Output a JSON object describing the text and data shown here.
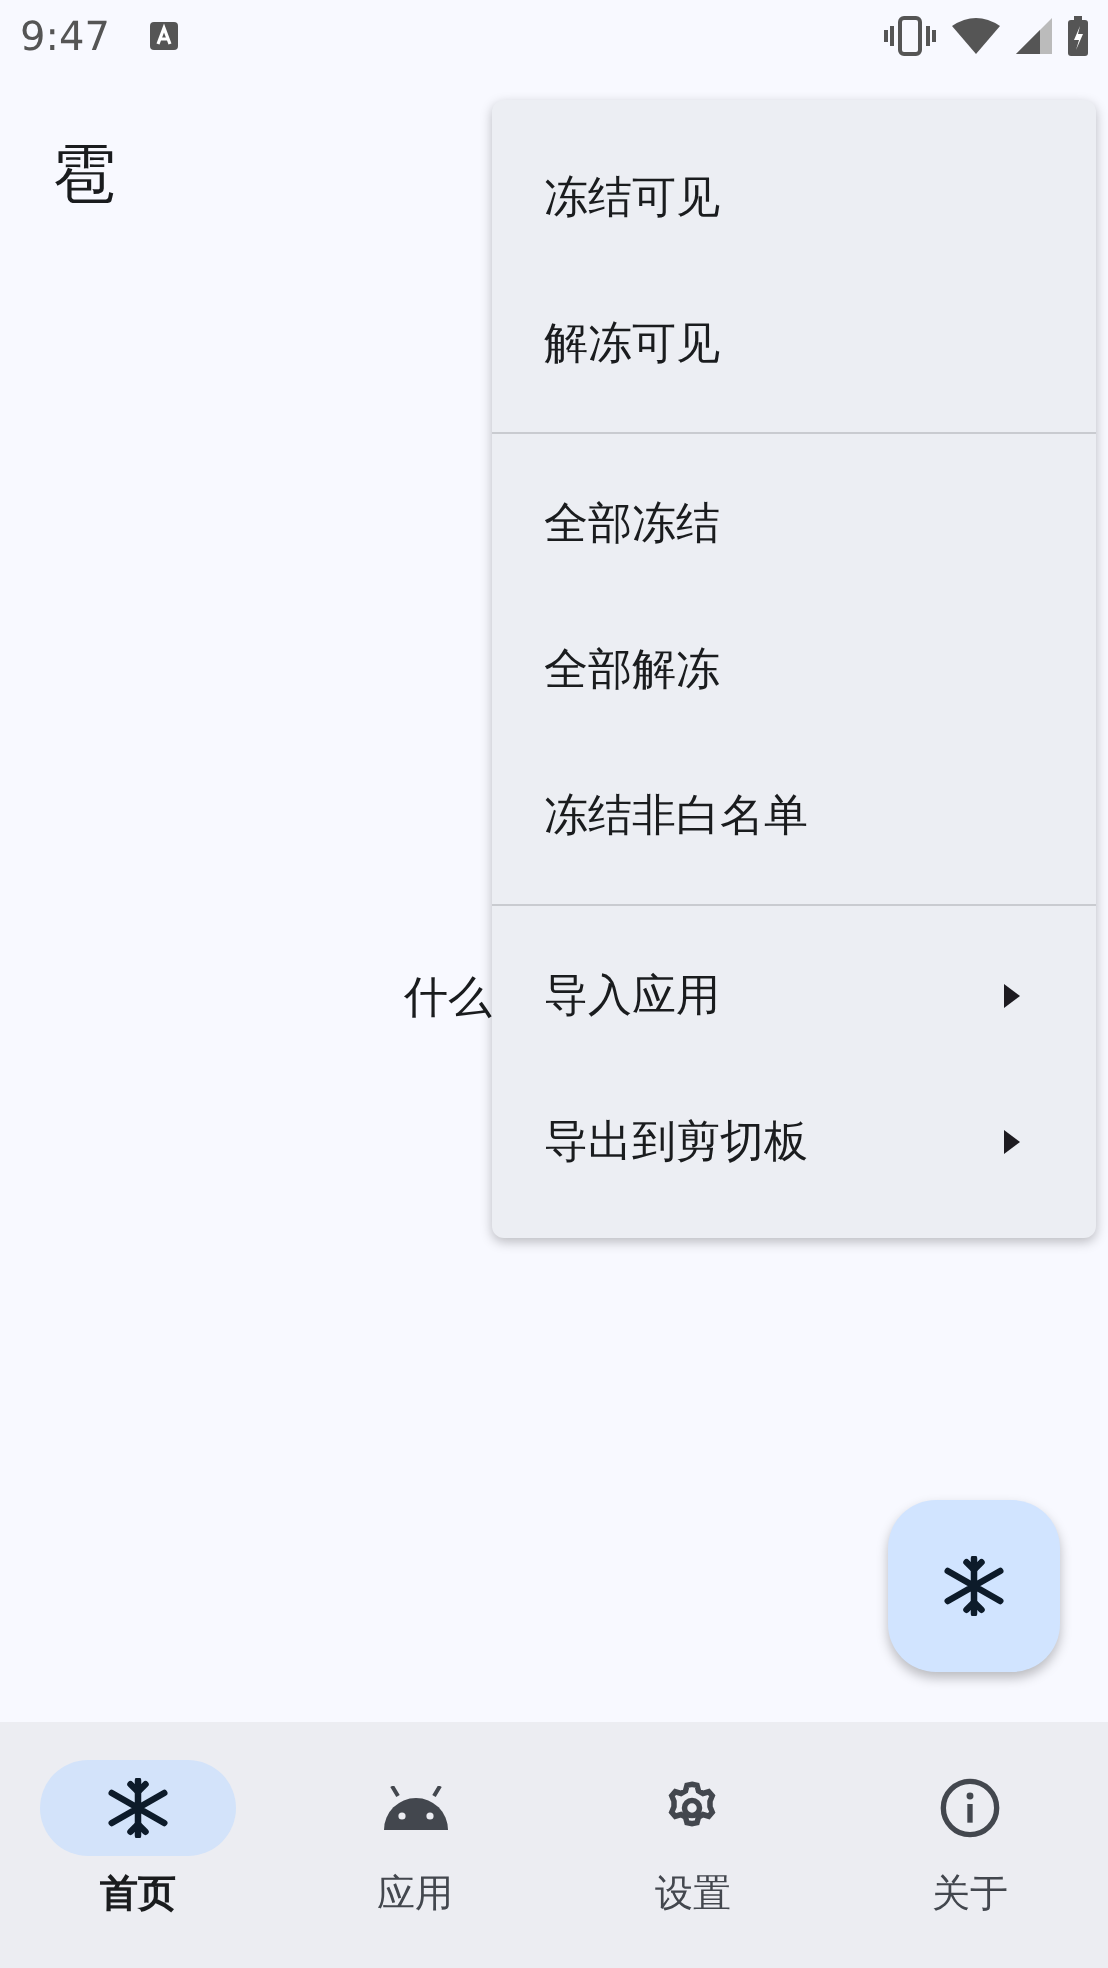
{
  "status_bar": {
    "time": "9:47"
  },
  "app_bar": {
    "title": "雹"
  },
  "body": {
    "text": "什么"
  },
  "menu": {
    "groups": [
      {
        "items": [
          {
            "label": "冻结可见",
            "kind": "action"
          },
          {
            "label": "解冻可见",
            "kind": "action"
          }
        ]
      },
      {
        "items": [
          {
            "label": "全部冻结",
            "kind": "action"
          },
          {
            "label": "全部解冻",
            "kind": "action"
          },
          {
            "label": "冻结非白名单",
            "kind": "action"
          }
        ]
      },
      {
        "items": [
          {
            "label": "导入应用",
            "kind": "submenu"
          },
          {
            "label": "导出到剪切板",
            "kind": "submenu"
          }
        ]
      }
    ]
  },
  "fab": {
    "kind": "freeze"
  },
  "nav": [
    {
      "label": "首页",
      "kind": "home",
      "selected": true
    },
    {
      "label": "应用",
      "kind": "apps",
      "selected": false
    },
    {
      "label": "设置",
      "kind": "settings",
      "selected": false
    },
    {
      "label": "关于",
      "kind": "about",
      "selected": false
    }
  ]
}
